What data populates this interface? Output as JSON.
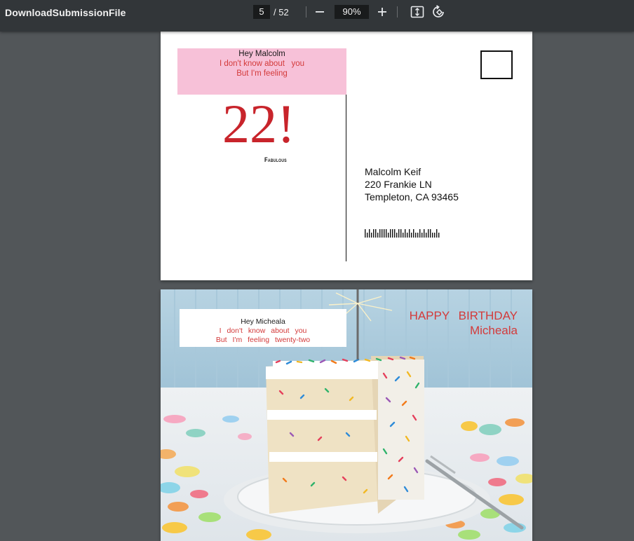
{
  "toolbar": {
    "title": "DownloadSubmissionFile",
    "current_page": "5",
    "total_pages": "/ 52",
    "zoom": "90%",
    "icons": [
      "minus-icon",
      "plus-icon",
      "fit-page-icon",
      "rotate-icon"
    ]
  },
  "page1": {
    "note_greeting": "Hey Malcolm",
    "note_line1": "I don't know about   you",
    "note_line2": "But I'm feeling",
    "big_number": "22!",
    "subtitle": "Fabulous",
    "address_name": "Malcolm Keif",
    "address_street": "220 Frankie LN",
    "address_city": "Templeton, CA 93465"
  },
  "page2": {
    "note_greeting": "Hey Micheala",
    "note_line1": "I don't know about you",
    "note_line2": "But I'm feeling twenty-two",
    "headline1": "HAPPY BIRTHDAY",
    "headline2": "Micheala"
  },
  "colors": {
    "viewer_bg": "#525659",
    "toolbar_bg": "#323639",
    "accent_red": "#c8242b",
    "note_pink": "#f7c1d8"
  }
}
